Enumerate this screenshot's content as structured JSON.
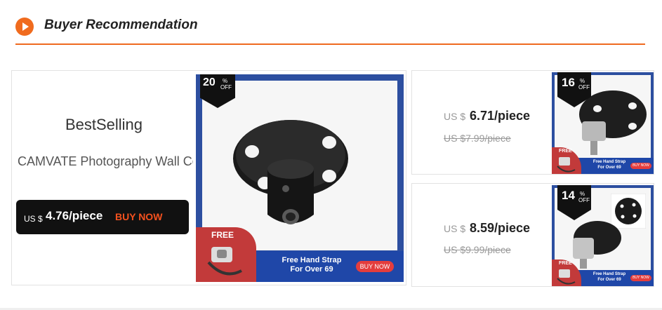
{
  "header": {
    "title": "Buyer Recommendation"
  },
  "main_card": {
    "heading": "BestSelling",
    "description": "CAMVATE Photography Wall Ceiling Table Mount Support",
    "currency": "US $",
    "price": "4.76/piece",
    "buy_label": "BUY NOW",
    "discount_num": "20",
    "discount_pct": "%",
    "discount_off": "OFF",
    "promo_line1": "Free Hand Strap",
    "promo_line2": "For Over 69",
    "promo_button": "BUY NOW",
    "free_label": "FREE"
  },
  "side_items": [
    {
      "currency": "US $",
      "price": "6.71/piece",
      "old_price": "US $7.99/piece",
      "discount_num": "16",
      "discount_pct": "%",
      "discount_off": "OFF",
      "promo_line1": "Free Hand Strap",
      "promo_line2": "For Over 69",
      "promo_button": "BUY NOW",
      "free_label": "FREE"
    },
    {
      "currency": "US $",
      "price": "8.59/piece",
      "old_price": "US $9.99/piece",
      "discount_num": "14",
      "discount_pct": "%",
      "discount_off": "OFF",
      "promo_line1": "Free Hand Strap",
      "promo_line2": "For Over 69",
      "promo_button": "BUY NOW",
      "free_label": "FREE"
    }
  ],
  "colors": {
    "accent": "#ef6a1f",
    "promo_blue": "#1f47a8",
    "buy_red": "#f4511e"
  }
}
